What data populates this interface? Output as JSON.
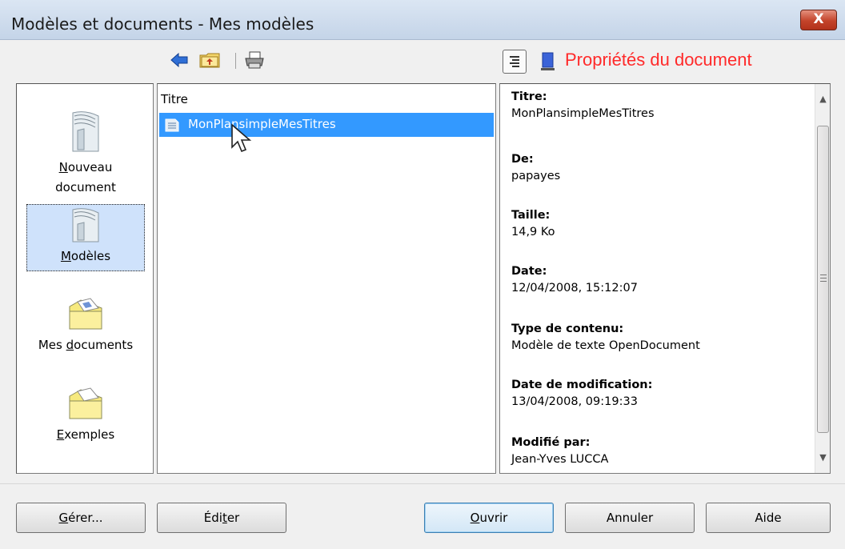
{
  "window": {
    "title": "Modèles et documents - Mes modèles",
    "close_label": "X"
  },
  "toolbar": {
    "back_icon": "back-arrow-icon",
    "up_icon": "folder-up-icon",
    "print_icon": "printer-icon",
    "view_toggle_icon": "document-list-icon",
    "preview_icon": "preview-icon",
    "properties_label": "Propriétés du document",
    "properties_color": "#ff2a2a"
  },
  "categories": [
    {
      "label_pre": "",
      "label_mnemonic": "N",
      "label_post": "ouveau",
      "label_line2": "document",
      "selected": false,
      "icon": "new-document-icon"
    },
    {
      "label_pre": "",
      "label_mnemonic": "M",
      "label_post": "odèles",
      "selected": true,
      "icon": "templates-icon"
    },
    {
      "label_pre": "Mes ",
      "label_mnemonic": "d",
      "label_post": "ocuments",
      "selected": false,
      "icon": "my-documents-folder-icon"
    },
    {
      "label_pre": "",
      "label_mnemonic": "E",
      "label_post": "xemples",
      "selected": false,
      "icon": "examples-folder-icon"
    }
  ],
  "list": {
    "column_header": "Titre",
    "items": [
      {
        "label": "MonPlansimpleMesTitres",
        "selected": true,
        "icon": "template-file-icon"
      }
    ]
  },
  "properties": [
    {
      "name": "Titre:",
      "value": "MonPlansimpleMesTitres"
    },
    {
      "name": "De:",
      "value": "papayes"
    },
    {
      "name": "Taille:",
      "value": "14,9 Ko"
    },
    {
      "name": "Date:",
      "value": "12/04/2008, 15:12:07"
    },
    {
      "name": "Type de contenu:",
      "value": "Modèle de texte OpenDocument"
    },
    {
      "name": "Date de modification:",
      "value": "13/04/2008, 09:19:33"
    },
    {
      "name": "Modifié par:",
      "value": "Jean-Yves LUCCA"
    }
  ],
  "buttons": {
    "manage": {
      "mnemonic": "G",
      "rest": "érer..."
    },
    "edit": {
      "pre": "Édi",
      "mnemonic": "t",
      "rest": "er"
    },
    "open": {
      "mnemonic": "O",
      "rest": "uvrir"
    },
    "cancel": "Annuler",
    "help": "Aide"
  }
}
